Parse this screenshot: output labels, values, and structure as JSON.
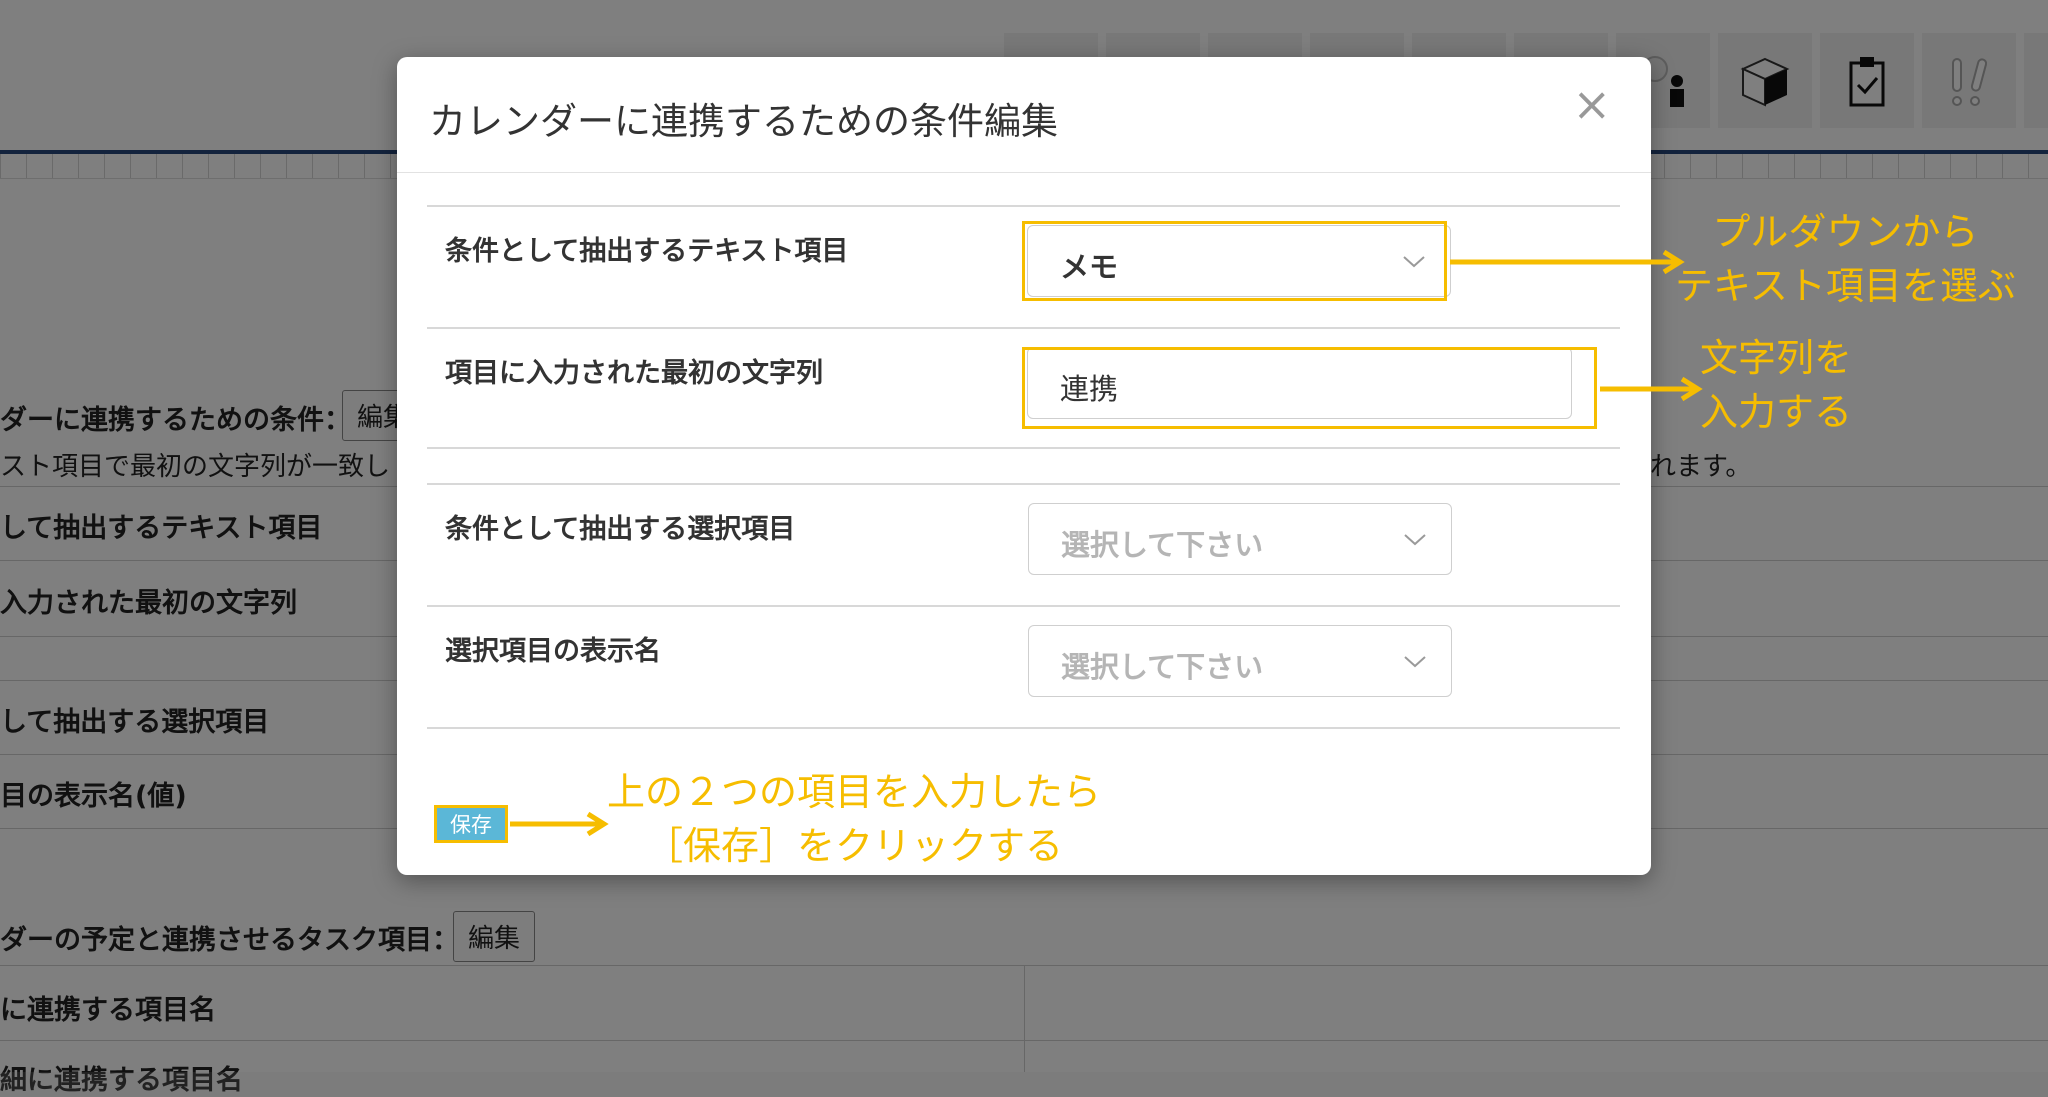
{
  "background": {
    "toolbar_icons": [
      "toolbar-icon-1",
      "toolbar-icon-2",
      "toolbar-icon-3",
      "toolbar-icon-4",
      "toolbar-icon-5",
      "toolbar-icon-6",
      "chat-user-icon",
      "box-icon",
      "clipboard-check-icon",
      "exclamation-icon",
      "toolbar-icon-11"
    ],
    "cond_heading": "ダーに連携するための条件：",
    "cond_edit": "編集",
    "cond_note_left": "スト項目で最初の文字列が一致し",
    "cond_note_right": "れます。",
    "rows": [
      "して抽出するテキスト項目",
      "入力された最初の文字列",
      "して抽出する選択項目",
      "目の表示名(値)"
    ],
    "task_heading": "ダーの予定と連携させるタスク項目：",
    "task_edit": "編集",
    "task_rows": [
      "に連携する項目名",
      "細に連携する項目名"
    ]
  },
  "modal": {
    "title": "カレンダーに連携するための条件編集",
    "close": "×",
    "fields": [
      {
        "label": "条件として抽出するテキスト項目",
        "value": "メモ"
      },
      {
        "label": "項目に入力された最初の文字列",
        "value": "連携"
      },
      {
        "label": "条件として抽出する選択項目",
        "placeholder": "選択して下さい"
      },
      {
        "label": "選択項目の表示名",
        "placeholder": "選択して下さい"
      }
    ],
    "save": "保存"
  },
  "annotations": {
    "pulldown": [
      "プルダウンから",
      "テキスト項目を選ぶ"
    ],
    "text_input": [
      "文字列を",
      "入力する"
    ],
    "save": [
      "上の２つの項目を入力したら",
      "［保存］をクリックする"
    ]
  },
  "colors": {
    "highlight": "#f6bd00",
    "header_line": "#27477a",
    "save_button": "#5bb7d7"
  }
}
